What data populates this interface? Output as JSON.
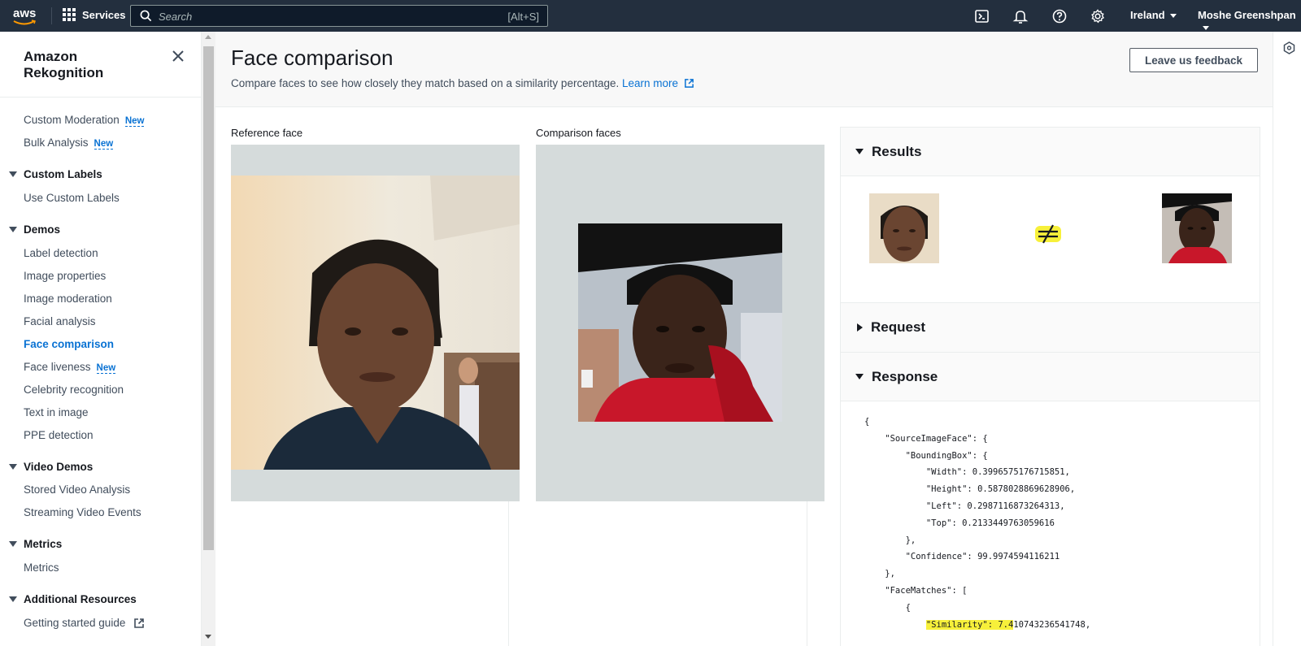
{
  "topnav": {
    "logo_text": "aws",
    "services_label": "Services",
    "search_placeholder": "Search",
    "search_shortcut": "[Alt+S]",
    "region": "Ireland",
    "user": "Moshe Greenshpan",
    "icons": [
      "cloudshell-icon",
      "bell-icon",
      "help-icon",
      "settings-icon"
    ]
  },
  "sidebar": {
    "title": "Amazon Rekognition",
    "top_links": [
      {
        "label": "Custom Moderation",
        "badge": "New"
      },
      {
        "label": "Bulk Analysis",
        "badge": "New"
      }
    ],
    "sections": {
      "custom_labels": {
        "title": "Custom Labels",
        "items": [
          "Use Custom Labels"
        ]
      },
      "demos": {
        "title": "Demos",
        "items": [
          "Label detection",
          "Image properties",
          "Image moderation",
          "Facial analysis",
          "Face comparison",
          "Face liveness",
          "Celebrity recognition",
          "Text in image",
          "PPE detection"
        ],
        "active": "Face comparison",
        "badge": "New"
      },
      "video_demos": {
        "title": "Video Demos",
        "items": [
          "Stored Video Analysis",
          "Streaming Video Events"
        ]
      },
      "metrics": {
        "title": "Metrics",
        "items": [
          "Metrics"
        ]
      },
      "additional": {
        "title": "Additional Resources",
        "items": [
          "Getting started guide"
        ]
      }
    }
  },
  "main": {
    "title": "Face comparison",
    "description": "Compare faces to see how closely they match based on a similarity percentage.",
    "learn_more": "Learn more",
    "feedback_button": "Leave us feedback",
    "reference_label": "Reference face",
    "comparison_label": "Comparison faces"
  },
  "results": {
    "results_title": "Results",
    "request_title": "Request",
    "response_title": "Response",
    "match_symbol": "≠",
    "response_lines": [
      "{",
      "    \"SourceImageFace\": {",
      "        \"BoundingBox\": {",
      "            \"Width\": 0.3996575176715851,",
      "            \"Height\": 0.5878028869628906,",
      "            \"Left\": 0.2987116873264313,",
      "            \"Top\": 0.2133449763059616",
      "        },",
      "        \"Confidence\": 99.9974594116211",
      "    },",
      "    \"FaceMatches\": [",
      "        {"
    ],
    "similarity_key": "\"Similarity\": 7.4",
    "similarity_rest": "10743236541748,"
  }
}
